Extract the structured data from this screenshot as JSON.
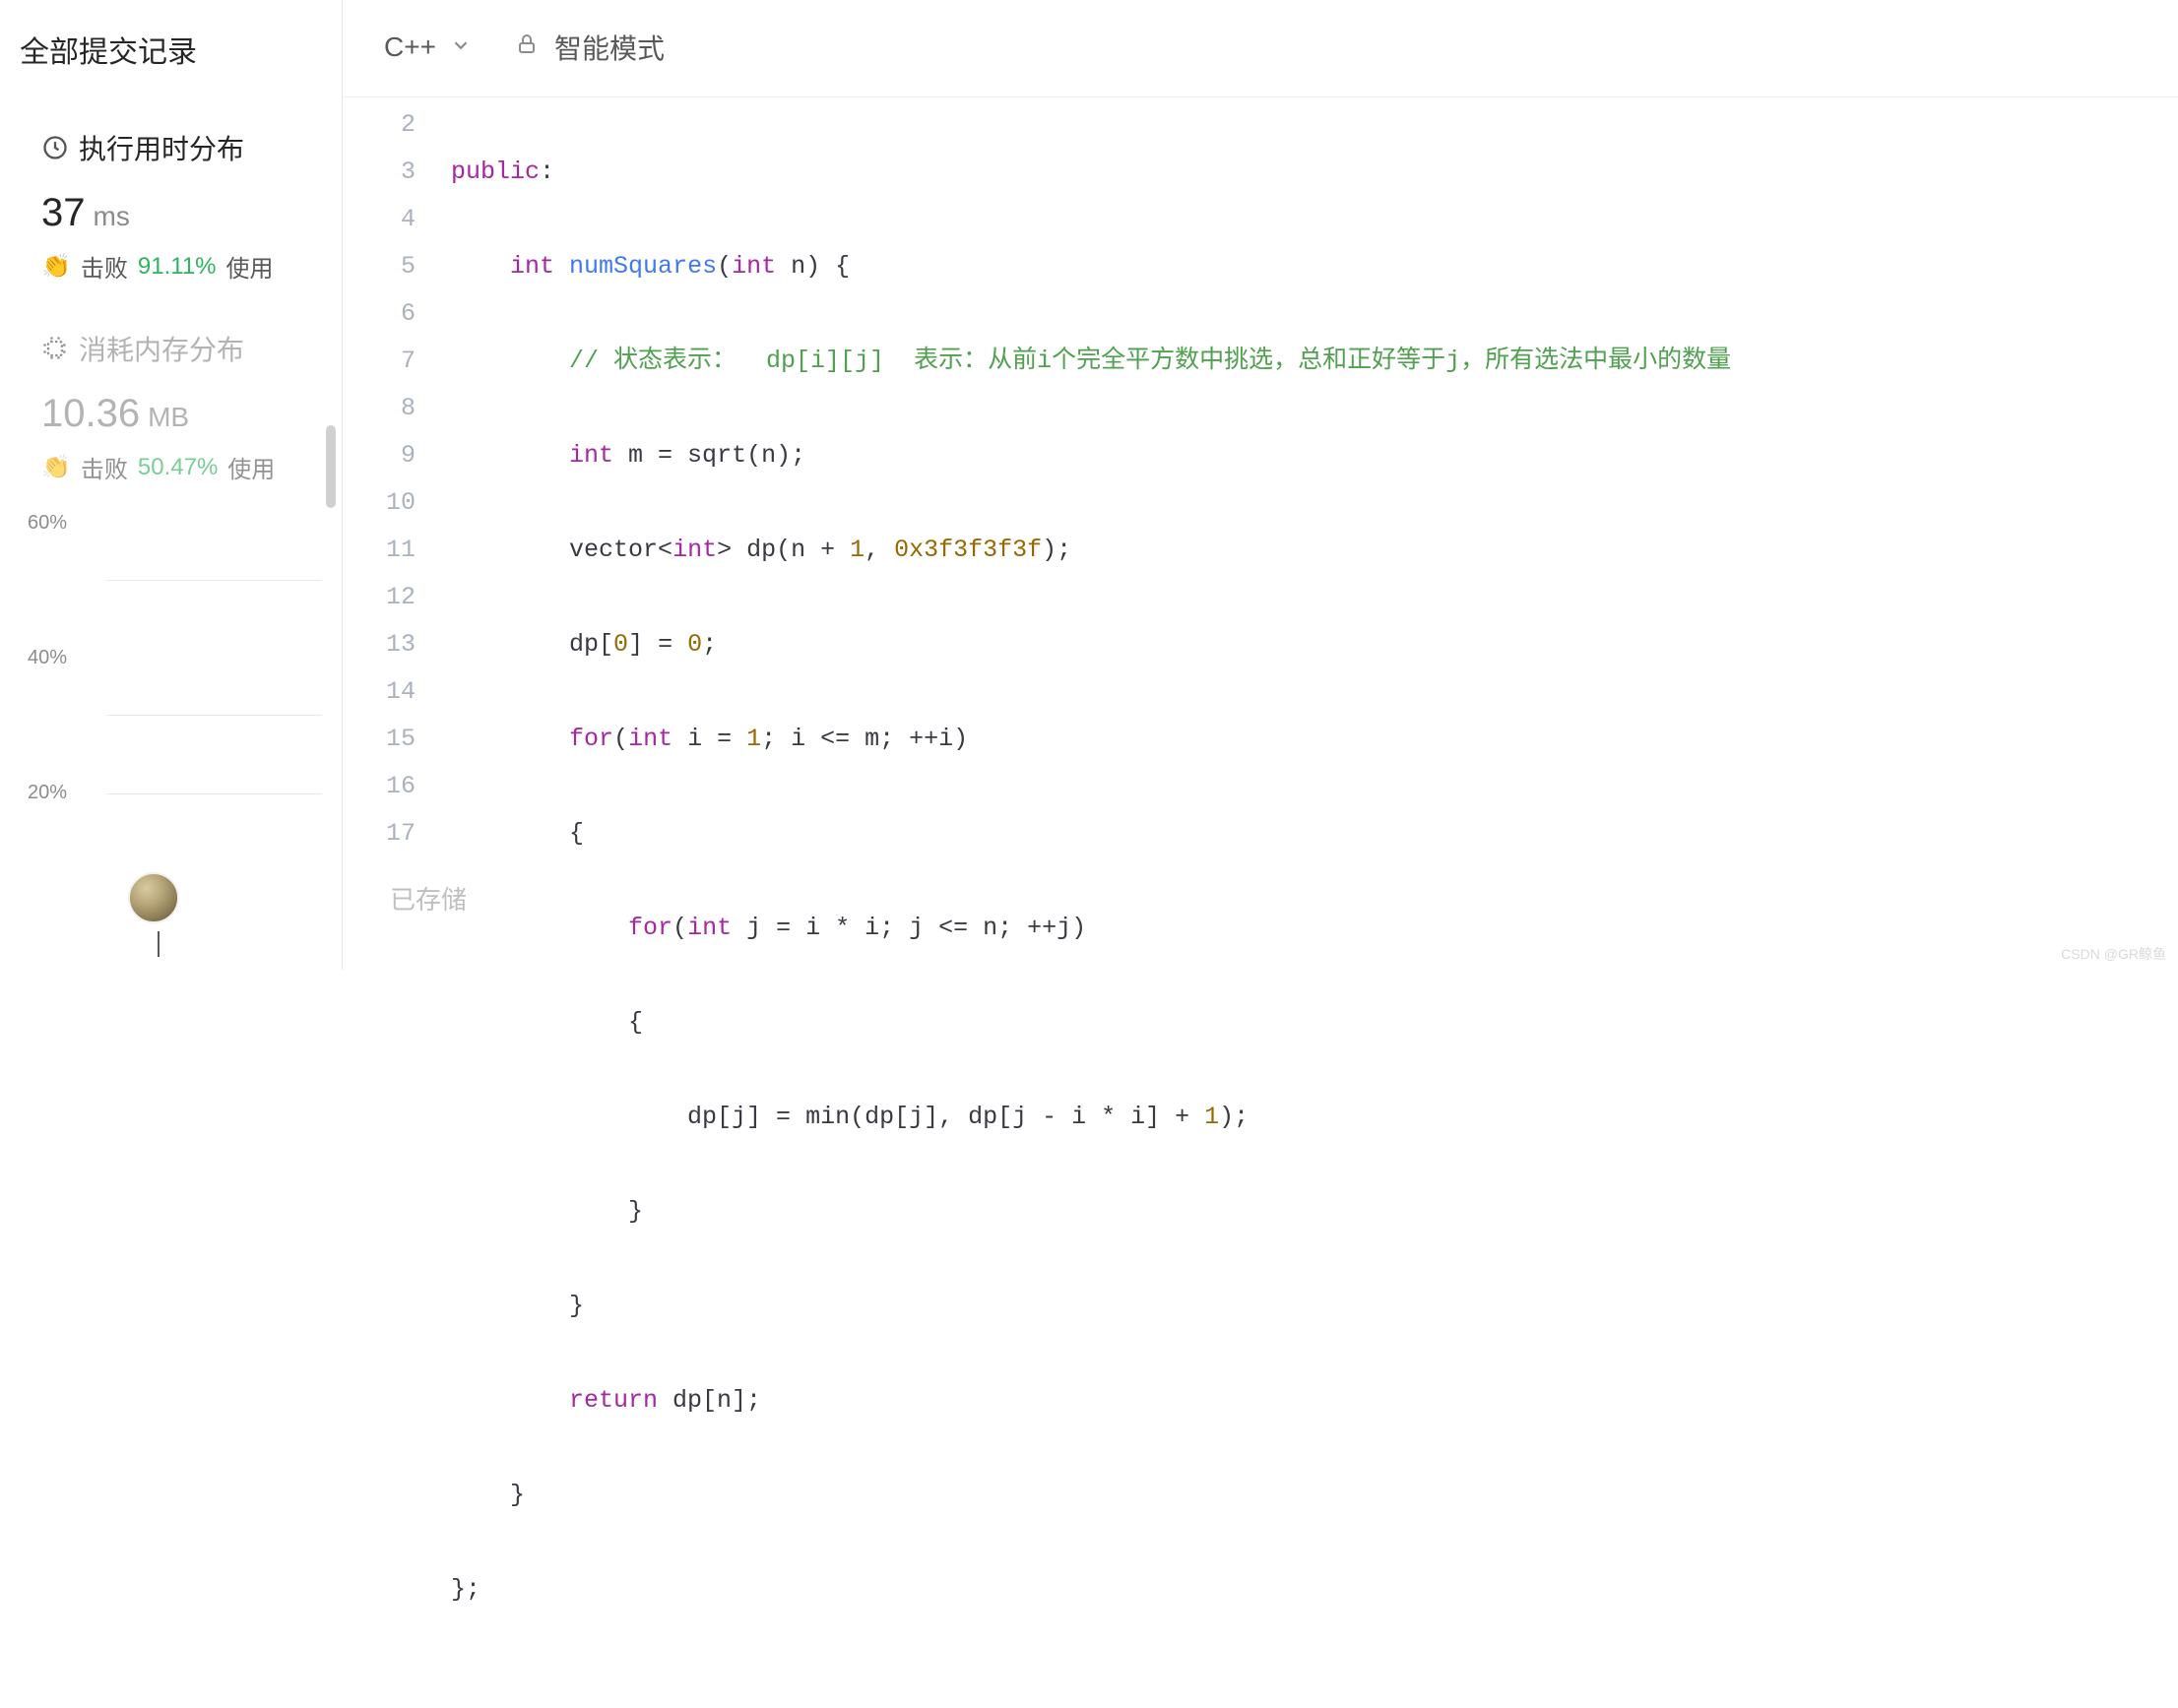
{
  "sidebar": {
    "title": "全部提交记录",
    "runtime": {
      "label": "执行用时分布",
      "value": "37",
      "unit": "ms",
      "beats_prefix": "击败",
      "beats_percent": "91.11%",
      "beats_suffix": "使用"
    },
    "memory": {
      "label": "消耗内存分布",
      "value": "10.36",
      "unit": "MB",
      "beats_prefix": "击败",
      "beats_percent": "50.47%",
      "beats_suffix": "使用"
    },
    "yticks": [
      "60%",
      "40%",
      "20%"
    ]
  },
  "toolbar": {
    "language": "C++",
    "mode": "智能模式"
  },
  "code": {
    "lines": [
      2,
      3,
      4,
      5,
      6,
      7,
      8,
      9,
      10,
      11,
      12,
      13,
      14,
      15,
      16,
      17
    ]
  },
  "code_text": {
    "l2a": "public",
    "l3a": "int",
    "l3b": "numSquares",
    "l3c": "int",
    "l3d": " n",
    "l4a": "// 状态表示：  dp[i][j]  表示：从前i个完全平方数中挑选，总和正好等于j，所有选法中最小的数量",
    "l5a": "int",
    "l5b": " m = sqrt(n);",
    "l6a": "vector<",
    "l6b": "int",
    "l6c": "> dp(n + ",
    "l6d": "1",
    "l6e": ", ",
    "l6f": "0x3f3f3f3f",
    "l6g": ");",
    "l7a": "dp[",
    "l7b": "0",
    "l7c": "] = ",
    "l7d": "0",
    "l7e": ";",
    "l8a": "for",
    "l8b": "(",
    "l8c": "int",
    "l8d": " i = ",
    "l8e": "1",
    "l8f": "; i <= m; ++i)",
    "l9a": "{",
    "l10a": "for",
    "l10b": "(",
    "l10c": "int",
    "l10d": " j = i * i; j <= n; ++j)",
    "l11a": "{",
    "l12a": "dp[j] = min(dp[j], dp[j - i * i] + ",
    "l12b": "1",
    "l12c": ");",
    "l13a": "}",
    "l14a": "}",
    "l15a": "return",
    "l15b": " dp[n];",
    "l16a": "}",
    "l17a": "};"
  },
  "status": {
    "saved": "已存储"
  },
  "watermark": "CSDN @GR鲸鱼"
}
